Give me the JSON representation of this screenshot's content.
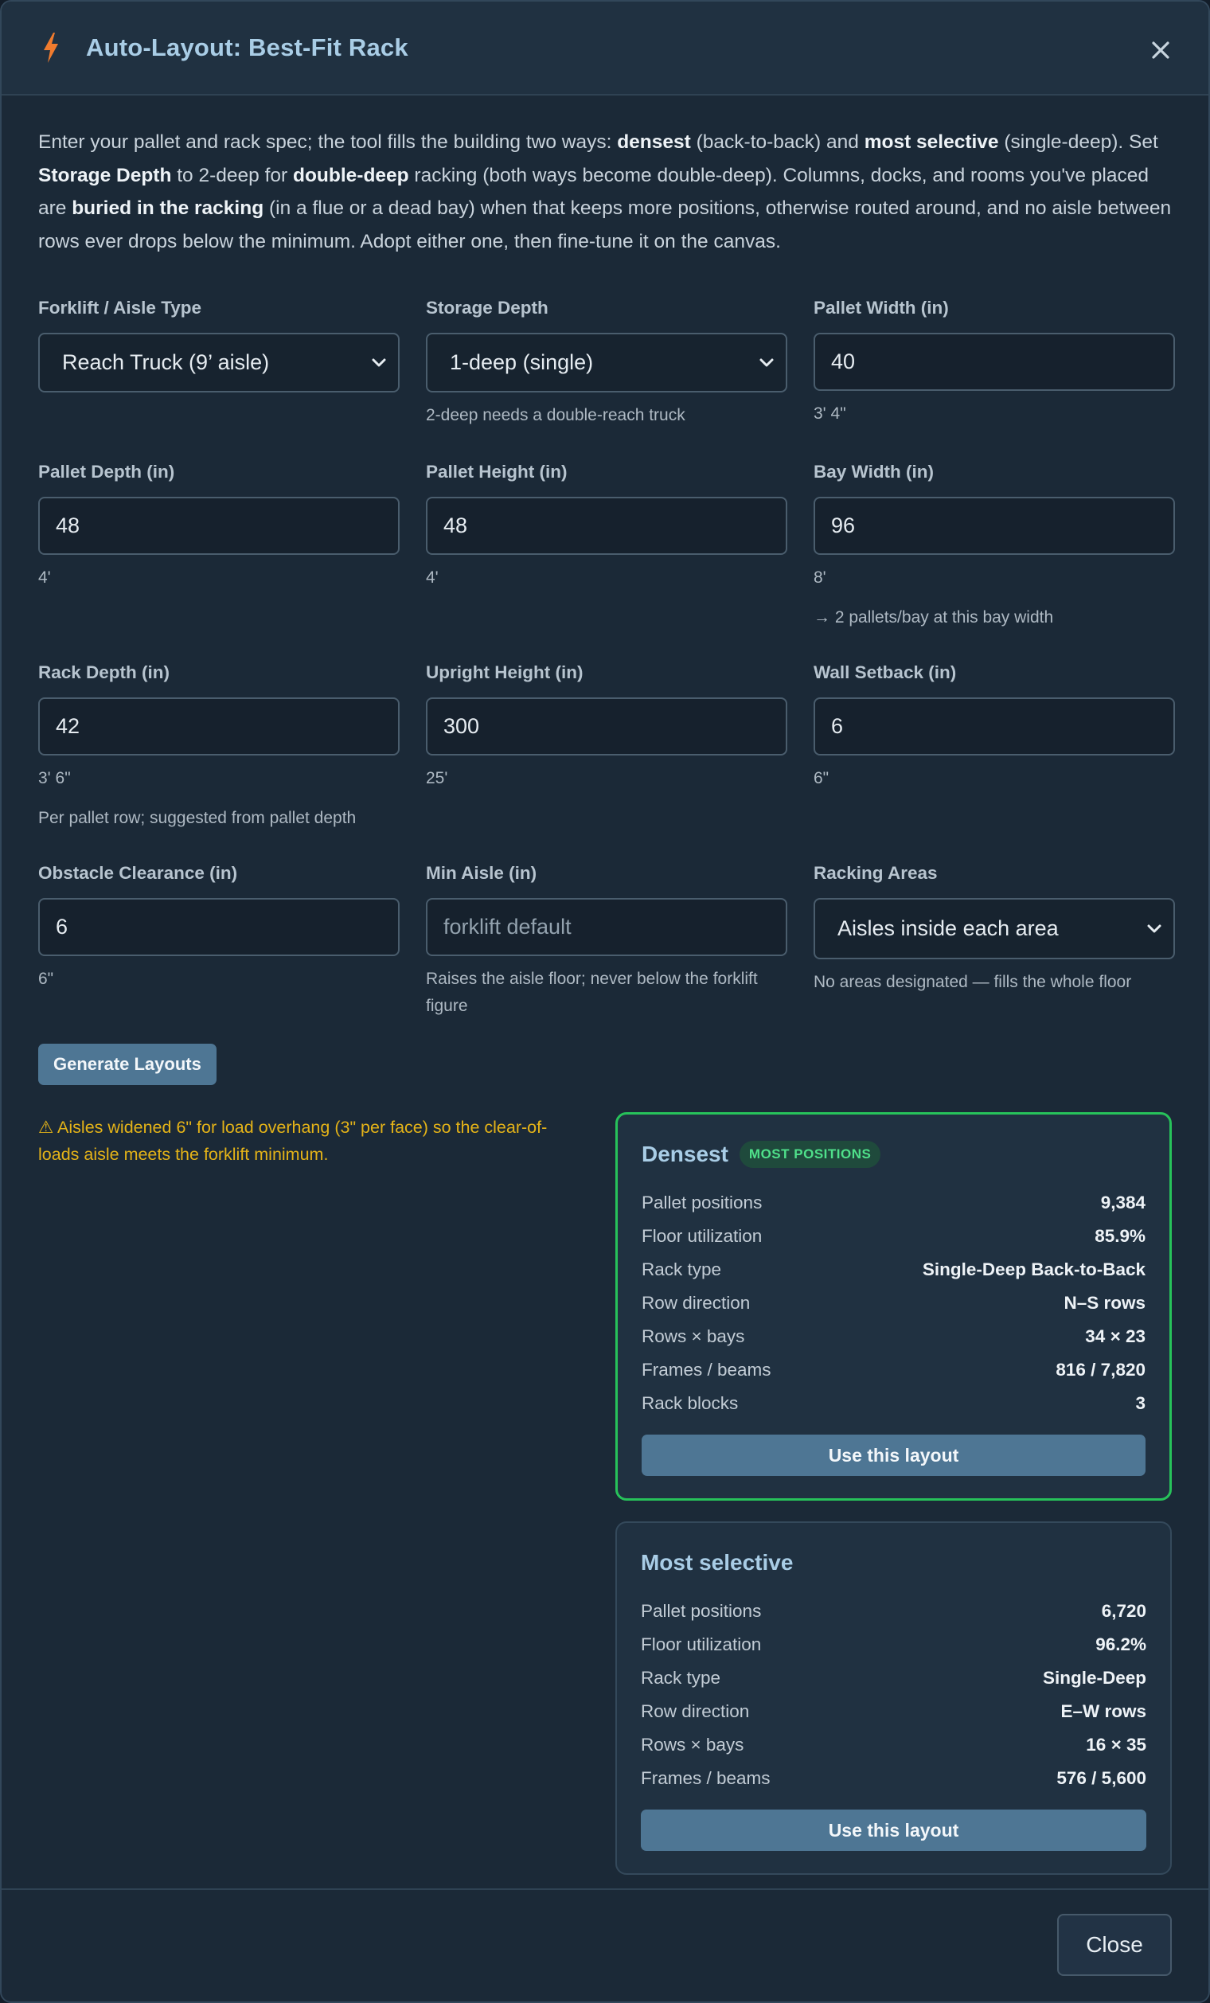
{
  "dialog": {
    "title": "Auto-Layout: Best-Fit Rack",
    "close_glyph": "×",
    "icons": {
      "title": "lightning-bolt-icon",
      "close": "close-icon"
    },
    "colors": {
      "accent": "#a9cde6",
      "bolt": "#f07b2e",
      "button": "#4e7694",
      "best_border": "#27c25a",
      "warning": "#e4b318"
    }
  },
  "intro": {
    "p1": "Enter your pallet and rack spec; the tool fills the building two ways: ",
    "b1": "densest",
    "p2": " (back-to-back) and ",
    "b2": "most selective",
    "p3": " (single-deep). Set ",
    "b3": "Storage Depth",
    "p4": " to 2-deep for ",
    "b4": "double-deep",
    "p5": " racking (both ways become double-deep). Columns, docks, and rooms you've placed are ",
    "b5": "buried in the racking",
    "p6": " (in a flue or a dead bay) when that keeps more positions, otherwise routed around, and no aisle between rows ever drops below the minimum. Adopt either one, then fine-tune it on the canvas."
  },
  "fields": {
    "forklift": {
      "label": "Forklift / Aisle Type",
      "value": "Reach Truck (9’ aisle)"
    },
    "storage_depth": {
      "label": "Storage Depth",
      "value": "1-deep (single)",
      "hint": "2-deep needs a double-reach truck"
    },
    "pallet_width": {
      "label": "Pallet Width (in)",
      "value": "40",
      "hint": "3' 4\""
    },
    "pallet_depth": {
      "label": "Pallet Depth (in)",
      "value": "48",
      "hint": "4'"
    },
    "pallet_height": {
      "label": "Pallet Height (in)",
      "value": "48",
      "hint": "4'"
    },
    "bay_width": {
      "label": "Bay Width (in)",
      "value": "96",
      "hint": "8'",
      "hint2": "→ 2 pallets/bay at this bay width"
    },
    "rack_depth": {
      "label": "Rack Depth (in)",
      "value": "42",
      "hint": "3' 6\"",
      "hint2": "Per pallet row; suggested from pallet depth"
    },
    "upright_height": {
      "label": "Upright Height (in)",
      "value": "300",
      "hint": "25'"
    },
    "wall_setback": {
      "label": "Wall Setback (in)",
      "value": "6",
      "hint": "6\""
    },
    "obstacle_clearance": {
      "label": "Obstacle Clearance (in)",
      "value": "6",
      "hint": "6\""
    },
    "min_aisle": {
      "label": "Min Aisle (in)",
      "placeholder": "forklift default",
      "hint": "Raises the aisle floor; never below the forklift figure"
    },
    "racking_areas": {
      "label": "Racking Areas",
      "value": "Aisles inside each area",
      "hint": "No areas designated — fills the whole floor"
    }
  },
  "generate_label": "Generate Layouts",
  "warning": "⚠ Aisles widened 6\" for load overhang (3\" per face) so the clear-of-loads aisle meets the forklift minimum.",
  "densest": {
    "title": "Densest",
    "badge": "MOST POSITIONS",
    "stats": [
      {
        "k": "Pallet positions",
        "v": "9,384"
      },
      {
        "k": "Floor utilization",
        "v": "85.9%"
      },
      {
        "k": "Rack type",
        "v": "Single-Deep Back-to-Back"
      },
      {
        "k": "Row direction",
        "v": "N–S rows"
      },
      {
        "k": "Rows × bays",
        "v": "34 × 23"
      },
      {
        "k": "Frames / beams",
        "v": "816 / 7,820"
      },
      {
        "k": "Rack blocks",
        "v": "3"
      }
    ],
    "button": "Use this layout"
  },
  "selective": {
    "title": "Most selective",
    "stats": [
      {
        "k": "Pallet positions",
        "v": "6,720"
      },
      {
        "k": "Floor utilization",
        "v": "96.2%"
      },
      {
        "k": "Rack type",
        "v": "Single-Deep"
      },
      {
        "k": "Row direction",
        "v": "E–W rows"
      },
      {
        "k": "Rows × bays",
        "v": "16 × 35"
      },
      {
        "k": "Frames / beams",
        "v": "576 / 5,600"
      }
    ],
    "button": "Use this layout"
  },
  "footer": {
    "close_label": "Close"
  }
}
